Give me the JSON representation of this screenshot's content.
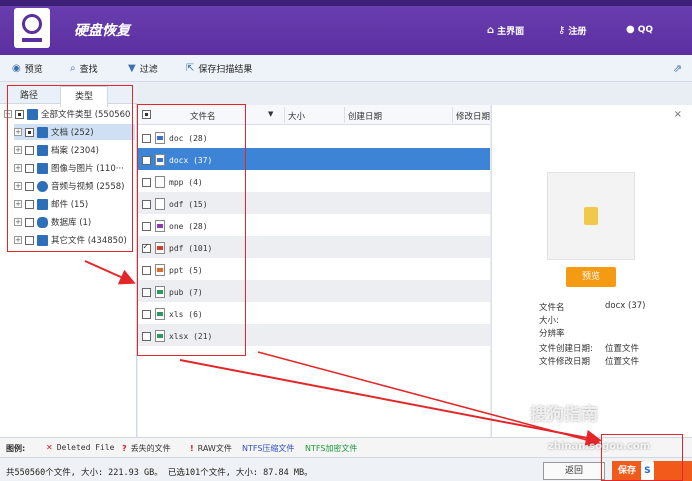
{
  "header": {
    "title": "硬盘恢复",
    "home_label": "主界面",
    "register_label": "注册",
    "qq_label": "QQ"
  },
  "toolbar": {
    "preview": "预览",
    "find": "查找",
    "filter": "过滤",
    "save_scan": "保存扫描结果"
  },
  "left": {
    "tab_path": "路径",
    "tab_type": "类型",
    "tree": [
      {
        "label": "全部文件类型 (550560",
        "icon": "monitor-icon",
        "color": "#2d6fb8"
      },
      {
        "label": "文档 (252)",
        "icon": "document-icon",
        "color": "#2d6fb8"
      },
      {
        "label": "档案 (2304)",
        "icon": "archive-icon",
        "color": "#2d6fb8"
      },
      {
        "label": "图像与图片 (110···",
        "icon": "image-icon",
        "color": "#2d6fb8"
      },
      {
        "label": "音频与视频 (2558)",
        "icon": "play-icon",
        "color": "#2d6fb8"
      },
      {
        "label": "邮件 (15)",
        "icon": "mail-icon",
        "color": "#2d6fb8"
      },
      {
        "label": "数据库 (1)",
        "icon": "database-icon",
        "color": "#2d6fb8"
      },
      {
        "label": "其它文件 (434850)",
        "icon": "folder-icon",
        "color": "#2d6fb8"
      }
    ]
  },
  "list": {
    "headers": [
      "文件名",
      "大小",
      "创建日期",
      "修改日期"
    ],
    "rows": [
      {
        "name": "doc (28)",
        "color": "#3b6fd0"
      },
      {
        "name": "docx (37)",
        "color": "#3b6fd0"
      },
      {
        "name": "mpp (4)",
        "color": "#aaaaaa"
      },
      {
        "name": "odf (15)",
        "color": "#aaaaaa"
      },
      {
        "name": "one (28)",
        "color": "#8a3fb0"
      },
      {
        "name": "pdf (101)",
        "color": "#d83a2a"
      },
      {
        "name": "ppt (5)",
        "color": "#e06a2a"
      },
      {
        "name": "pub (7)",
        "color": "#2a9a5a"
      },
      {
        "name": "xls (6)",
        "color": "#2a9a5a"
      },
      {
        "name": "xlsx (21)",
        "color": "#2a9a5a"
      }
    ]
  },
  "preview": {
    "button": "预览",
    "info": [
      {
        "k": "文件名",
        "v": "docx (37)"
      },
      {
        "k": "大小:",
        "v": ""
      },
      {
        "k": "分辨率",
        "v": ""
      },
      {
        "k": "文件创建日期:",
        "v": "位置文件"
      },
      {
        "k": "文件修改日期",
        "v": "位置文件"
      }
    ]
  },
  "legend": {
    "title": "图例:",
    "deleted": "Deleted File",
    "lost": "丢失的文件",
    "raw": "RAW文件",
    "ntfs_comp": "NTFS压缩文件",
    "ntfs_enc": "NTFS加密文件"
  },
  "status": {
    "text": "共550560个文件, 大小: 221.93 GB。 已选101个文件, 大小: 87.84 MB。",
    "back": "返回",
    "save": "保存"
  },
  "watermark": {
    "text1": "搜狗指南",
    "text2": "zhinan.sogou.com"
  }
}
